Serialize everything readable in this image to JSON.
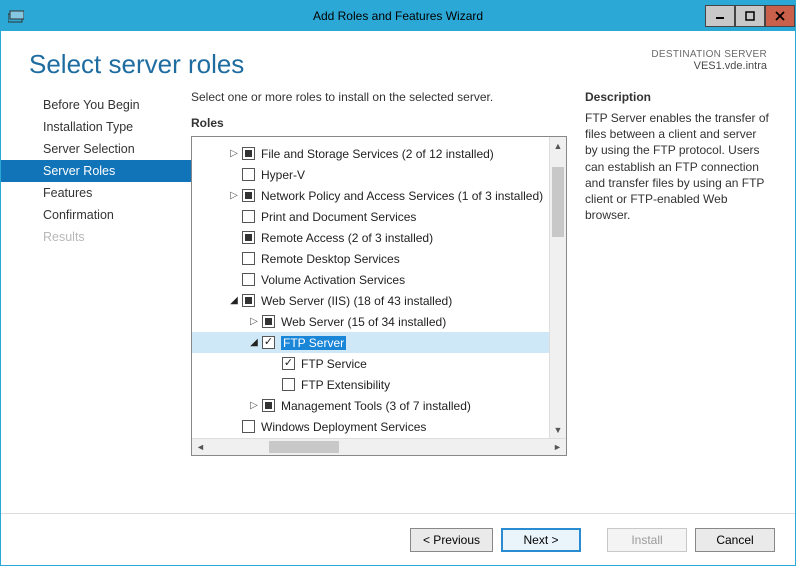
{
  "window": {
    "title": "Add Roles and Features Wizard"
  },
  "header": {
    "page_title": "Select server roles",
    "destination_label": "DESTINATION SERVER",
    "destination_value": "VES1.vde.intra"
  },
  "sidebar": {
    "items": [
      {
        "label": "Before You Begin",
        "state": "normal"
      },
      {
        "label": "Installation Type",
        "state": "normal"
      },
      {
        "label": "Server Selection",
        "state": "normal"
      },
      {
        "label": "Server Roles",
        "state": "selected"
      },
      {
        "label": "Features",
        "state": "normal"
      },
      {
        "label": "Confirmation",
        "state": "normal"
      },
      {
        "label": "Results",
        "state": "disabled"
      }
    ]
  },
  "main": {
    "instruction": "Select one or more roles to install on the selected server.",
    "roles_label": "Roles",
    "tree": [
      {
        "indent": 1,
        "expander": "collapsed",
        "check": "partial",
        "label": "File and Storage Services (2 of 12 installed)"
      },
      {
        "indent": 1,
        "expander": "none",
        "check": "none",
        "label": "Hyper-V"
      },
      {
        "indent": 1,
        "expander": "collapsed",
        "check": "partial",
        "label": "Network Policy and Access Services (1 of 3 installed)"
      },
      {
        "indent": 1,
        "expander": "none",
        "check": "none",
        "label": "Print and Document Services"
      },
      {
        "indent": 1,
        "expander": "none",
        "check": "partial",
        "label": "Remote Access (2 of 3 installed)"
      },
      {
        "indent": 1,
        "expander": "none",
        "check": "none",
        "label": "Remote Desktop Services"
      },
      {
        "indent": 1,
        "expander": "none",
        "check": "none",
        "label": "Volume Activation Services"
      },
      {
        "indent": 1,
        "expander": "expanded",
        "check": "partial",
        "label": "Web Server (IIS) (18 of 43 installed)"
      },
      {
        "indent": 2,
        "expander": "collapsed",
        "check": "partial",
        "label": "Web Server (15 of 34 installed)"
      },
      {
        "indent": 2,
        "expander": "expanded",
        "check": "checked",
        "label": "FTP Server",
        "highlight": true,
        "selected": true
      },
      {
        "indent": 3,
        "expander": "none",
        "check": "checked",
        "label": "FTP Service"
      },
      {
        "indent": 3,
        "expander": "none",
        "check": "none",
        "label": "FTP Extensibility"
      },
      {
        "indent": 2,
        "expander": "collapsed",
        "check": "partial",
        "label": "Management Tools (3 of 7 installed)"
      },
      {
        "indent": 1,
        "expander": "none",
        "check": "none",
        "label": "Windows Deployment Services"
      }
    ],
    "description_label": "Description",
    "description_text": "FTP Server enables the transfer of files between a client and server by using the FTP protocol. Users can establish an FTP connection and transfer files by using an FTP client or FTP-enabled Web browser."
  },
  "footer": {
    "previous": "< Previous",
    "next": "Next >",
    "install": "Install",
    "cancel": "Cancel"
  }
}
